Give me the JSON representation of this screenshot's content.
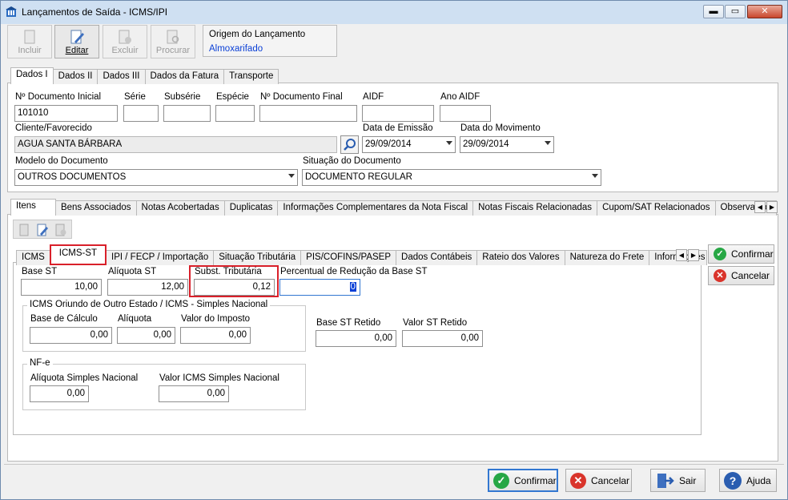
{
  "window": {
    "title": "Lançamentos de Saída - ICMS/IPI",
    "controls": {
      "minimize": "▬",
      "restore": "▭",
      "close": "✕"
    }
  },
  "toolbar": {
    "incluir": "Incluir",
    "editar": "Editar",
    "excluir": "Excluir",
    "procurar": "Procurar"
  },
  "origin": {
    "label": "Origem do Lançamento",
    "value": "Almoxarifado"
  },
  "top_tabs": [
    "Dados I",
    "Dados II",
    "Dados III",
    "Dados da Fatura",
    "Transporte"
  ],
  "form": {
    "doc_inicial_label": "Nº Documento Inicial",
    "doc_inicial": "101010",
    "serie_label": "Série",
    "serie": "",
    "subserie_label": "Subsérie",
    "subserie": "",
    "especie_label": "Espécie",
    "especie": "",
    "doc_final_label": "Nº Documento Final",
    "doc_final": "",
    "aidf_label": "AIDF",
    "aidf": "",
    "ano_aidf_label": "Ano AIDF",
    "ano_aidf": "",
    "cliente_label": "Cliente/Favorecido",
    "cliente": "AGUA SANTA BÁRBARA",
    "data_emissao_label": "Data de Emissão",
    "data_emissao": "29/09/2014",
    "data_mov_label": "Data do Movimento",
    "data_mov": "29/09/2014",
    "modelo_label": "Modelo do Documento",
    "modelo": "OUTROS DOCUMENTOS",
    "situacao_label": "Situação do Documento",
    "situacao": "DOCUMENTO REGULAR"
  },
  "mid_tabs": [
    "Itens",
    "Bens Associados",
    "Notas Acobertadas",
    "Duplicatas",
    "Informações Complementares da Nota Fiscal",
    "Notas Fiscais Relacionadas",
    "Cupom/SAT Relacionados",
    "Observação do"
  ],
  "inner_tabs": [
    "ICMS",
    "ICMS-ST",
    "IPI / FECP / Importação",
    "Situação Tributária",
    "PIS/COFINS/PASEP",
    "Dados Contábeis",
    "Rateio dos Valores",
    "Natureza do Frete",
    "Informações"
  ],
  "icms_st": {
    "base_st_label": "Base ST",
    "base_st": "10,00",
    "aliquota_st_label": "Alíquota ST",
    "aliquota_st": "12,00",
    "subst_label": "Subst. Tributária",
    "subst": "0,12",
    "percentual_label": "Percentual de Redução da Base ST",
    "percentual": "0",
    "group1_title": "ICMS Oriundo de Outro Estado / ICMS - Simples Nacional",
    "base_calc_label": "Base de Cálculo",
    "base_calc": "0,00",
    "aliquota_label": "Alíquota",
    "aliquota": "0,00",
    "valor_imposto_label": "Valor do Imposto",
    "valor_imposto": "0,00",
    "base_retido_label": "Base ST Retido",
    "base_retido": "0,00",
    "valor_retido_label": "Valor ST Retido",
    "valor_retido": "0,00",
    "group2_title": "NF-e",
    "aliq_sn_label": "Alíquota Simples Nacional",
    "aliq_sn": "0,00",
    "valor_sn_label": "Valor ICMS Simples Nacional",
    "valor_sn": "0,00"
  },
  "side_buttons": {
    "confirmar": "Confirmar",
    "cancelar": "Cancelar"
  },
  "bottom_buttons": {
    "confirmar": "Confirmar",
    "cancelar": "Cancelar",
    "sair": "Sair",
    "ajuda": "Ajuda"
  },
  "colors": {
    "accent_blue": "#0a3fd6",
    "confirm_green": "#27a745",
    "cancel_red": "#d9342b",
    "help_blue": "#2a5db0",
    "highlight_red": "#d9202a"
  }
}
